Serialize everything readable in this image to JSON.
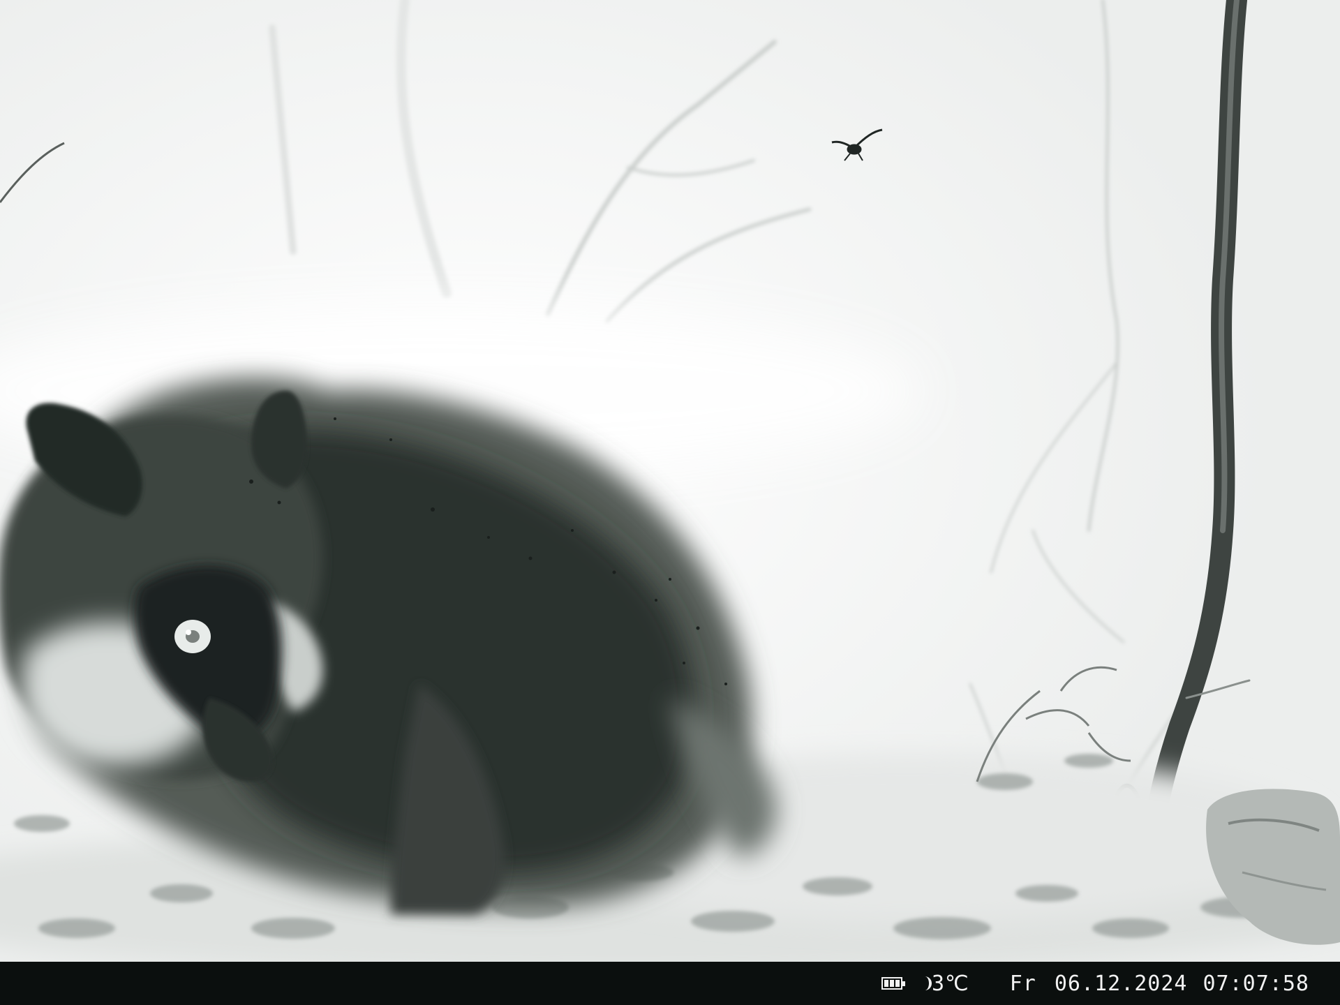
{
  "overlay": {
    "temperature": "3℃",
    "day": "Fr",
    "date": "06.12.2024",
    "time": "07:07:58"
  },
  "icons": {
    "battery": "battery-icon",
    "night_mode": "moon-icon"
  },
  "colors": {
    "status_bar_bg": "#0b0f0e",
    "status_text": "#f2f2f2",
    "scene_bg": "#f4f5f4",
    "fur_dark": "#2a302d"
  }
}
